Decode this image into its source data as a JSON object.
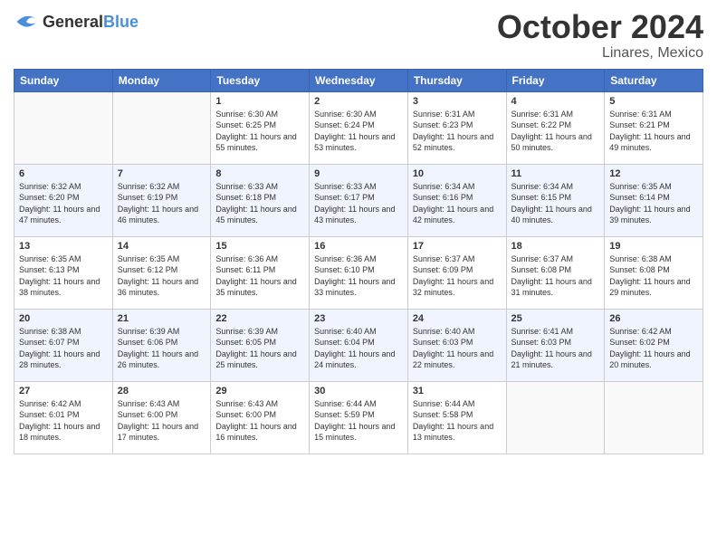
{
  "logo": {
    "general": "General",
    "blue": "Blue"
  },
  "title": "October 2024",
  "location": "Linares, Mexico",
  "days_of_week": [
    "Sunday",
    "Monday",
    "Tuesday",
    "Wednesday",
    "Thursday",
    "Friday",
    "Saturday"
  ],
  "weeks": [
    [
      {
        "day": "",
        "sunrise": "",
        "sunset": "",
        "daylight": ""
      },
      {
        "day": "",
        "sunrise": "",
        "sunset": "",
        "daylight": ""
      },
      {
        "day": "1",
        "sunrise": "Sunrise: 6:30 AM",
        "sunset": "Sunset: 6:25 PM",
        "daylight": "Daylight: 11 hours and 55 minutes."
      },
      {
        "day": "2",
        "sunrise": "Sunrise: 6:30 AM",
        "sunset": "Sunset: 6:24 PM",
        "daylight": "Daylight: 11 hours and 53 minutes."
      },
      {
        "day": "3",
        "sunrise": "Sunrise: 6:31 AM",
        "sunset": "Sunset: 6:23 PM",
        "daylight": "Daylight: 11 hours and 52 minutes."
      },
      {
        "day": "4",
        "sunrise": "Sunrise: 6:31 AM",
        "sunset": "Sunset: 6:22 PM",
        "daylight": "Daylight: 11 hours and 50 minutes."
      },
      {
        "day": "5",
        "sunrise": "Sunrise: 6:31 AM",
        "sunset": "Sunset: 6:21 PM",
        "daylight": "Daylight: 11 hours and 49 minutes."
      }
    ],
    [
      {
        "day": "6",
        "sunrise": "Sunrise: 6:32 AM",
        "sunset": "Sunset: 6:20 PM",
        "daylight": "Daylight: 11 hours and 47 minutes."
      },
      {
        "day": "7",
        "sunrise": "Sunrise: 6:32 AM",
        "sunset": "Sunset: 6:19 PM",
        "daylight": "Daylight: 11 hours and 46 minutes."
      },
      {
        "day": "8",
        "sunrise": "Sunrise: 6:33 AM",
        "sunset": "Sunset: 6:18 PM",
        "daylight": "Daylight: 11 hours and 45 minutes."
      },
      {
        "day": "9",
        "sunrise": "Sunrise: 6:33 AM",
        "sunset": "Sunset: 6:17 PM",
        "daylight": "Daylight: 11 hours and 43 minutes."
      },
      {
        "day": "10",
        "sunrise": "Sunrise: 6:34 AM",
        "sunset": "Sunset: 6:16 PM",
        "daylight": "Daylight: 11 hours and 42 minutes."
      },
      {
        "day": "11",
        "sunrise": "Sunrise: 6:34 AM",
        "sunset": "Sunset: 6:15 PM",
        "daylight": "Daylight: 11 hours and 40 minutes."
      },
      {
        "day": "12",
        "sunrise": "Sunrise: 6:35 AM",
        "sunset": "Sunset: 6:14 PM",
        "daylight": "Daylight: 11 hours and 39 minutes."
      }
    ],
    [
      {
        "day": "13",
        "sunrise": "Sunrise: 6:35 AM",
        "sunset": "Sunset: 6:13 PM",
        "daylight": "Daylight: 11 hours and 38 minutes."
      },
      {
        "day": "14",
        "sunrise": "Sunrise: 6:35 AM",
        "sunset": "Sunset: 6:12 PM",
        "daylight": "Daylight: 11 hours and 36 minutes."
      },
      {
        "day": "15",
        "sunrise": "Sunrise: 6:36 AM",
        "sunset": "Sunset: 6:11 PM",
        "daylight": "Daylight: 11 hours and 35 minutes."
      },
      {
        "day": "16",
        "sunrise": "Sunrise: 6:36 AM",
        "sunset": "Sunset: 6:10 PM",
        "daylight": "Daylight: 11 hours and 33 minutes."
      },
      {
        "day": "17",
        "sunrise": "Sunrise: 6:37 AM",
        "sunset": "Sunset: 6:09 PM",
        "daylight": "Daylight: 11 hours and 32 minutes."
      },
      {
        "day": "18",
        "sunrise": "Sunrise: 6:37 AM",
        "sunset": "Sunset: 6:08 PM",
        "daylight": "Daylight: 11 hours and 31 minutes."
      },
      {
        "day": "19",
        "sunrise": "Sunrise: 6:38 AM",
        "sunset": "Sunset: 6:08 PM",
        "daylight": "Daylight: 11 hours and 29 minutes."
      }
    ],
    [
      {
        "day": "20",
        "sunrise": "Sunrise: 6:38 AM",
        "sunset": "Sunset: 6:07 PM",
        "daylight": "Daylight: 11 hours and 28 minutes."
      },
      {
        "day": "21",
        "sunrise": "Sunrise: 6:39 AM",
        "sunset": "Sunset: 6:06 PM",
        "daylight": "Daylight: 11 hours and 26 minutes."
      },
      {
        "day": "22",
        "sunrise": "Sunrise: 6:39 AM",
        "sunset": "Sunset: 6:05 PM",
        "daylight": "Daylight: 11 hours and 25 minutes."
      },
      {
        "day": "23",
        "sunrise": "Sunrise: 6:40 AM",
        "sunset": "Sunset: 6:04 PM",
        "daylight": "Daylight: 11 hours and 24 minutes."
      },
      {
        "day": "24",
        "sunrise": "Sunrise: 6:40 AM",
        "sunset": "Sunset: 6:03 PM",
        "daylight": "Daylight: 11 hours and 22 minutes."
      },
      {
        "day": "25",
        "sunrise": "Sunrise: 6:41 AM",
        "sunset": "Sunset: 6:03 PM",
        "daylight": "Daylight: 11 hours and 21 minutes."
      },
      {
        "day": "26",
        "sunrise": "Sunrise: 6:42 AM",
        "sunset": "Sunset: 6:02 PM",
        "daylight": "Daylight: 11 hours and 20 minutes."
      }
    ],
    [
      {
        "day": "27",
        "sunrise": "Sunrise: 6:42 AM",
        "sunset": "Sunset: 6:01 PM",
        "daylight": "Daylight: 11 hours and 18 minutes."
      },
      {
        "day": "28",
        "sunrise": "Sunrise: 6:43 AM",
        "sunset": "Sunset: 6:00 PM",
        "daylight": "Daylight: 11 hours and 17 minutes."
      },
      {
        "day": "29",
        "sunrise": "Sunrise: 6:43 AM",
        "sunset": "Sunset: 6:00 PM",
        "daylight": "Daylight: 11 hours and 16 minutes."
      },
      {
        "day": "30",
        "sunrise": "Sunrise: 6:44 AM",
        "sunset": "Sunset: 5:59 PM",
        "daylight": "Daylight: 11 hours and 15 minutes."
      },
      {
        "day": "31",
        "sunrise": "Sunrise: 6:44 AM",
        "sunset": "Sunset: 5:58 PM",
        "daylight": "Daylight: 11 hours and 13 minutes."
      },
      {
        "day": "",
        "sunrise": "",
        "sunset": "",
        "daylight": ""
      },
      {
        "day": "",
        "sunrise": "",
        "sunset": "",
        "daylight": ""
      }
    ]
  ]
}
